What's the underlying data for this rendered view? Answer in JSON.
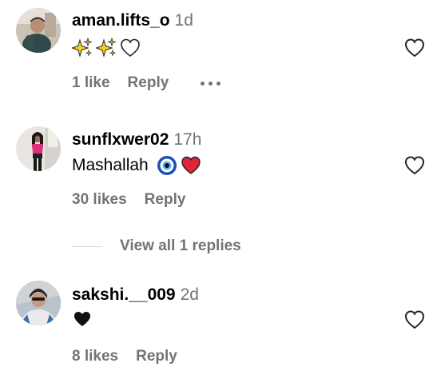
{
  "comments": [
    {
      "username": "aman.lifts_o",
      "time": "1d",
      "text": "",
      "emojis": [
        "sparkles-emoji",
        "sparkles-emoji",
        "white-heart-emoji"
      ],
      "likes": "1 like",
      "reply": "Reply",
      "has_more": true,
      "icon_like": "heart-outline-icon"
    },
    {
      "username": "sunflxwer02",
      "time": "17h",
      "text": "Mashallah",
      "emojis": [
        "nazar-amulet-emoji",
        "red-heart-emoji"
      ],
      "likes": "30 likes",
      "reply": "Reply",
      "icon_like": "heart-outline-icon"
    },
    {
      "username": "sakshi.__009",
      "time": "2d",
      "text": "",
      "emojis": [
        "black-heart-emoji"
      ],
      "likes": "8 likes",
      "reply": "Reply",
      "icon_like": "heart-outline-icon"
    }
  ],
  "view_replies": "View all 1 replies",
  "colors": {
    "secondary_text": "#737373",
    "divider": "#dbdbdb",
    "red_heart": "#e0243a"
  }
}
